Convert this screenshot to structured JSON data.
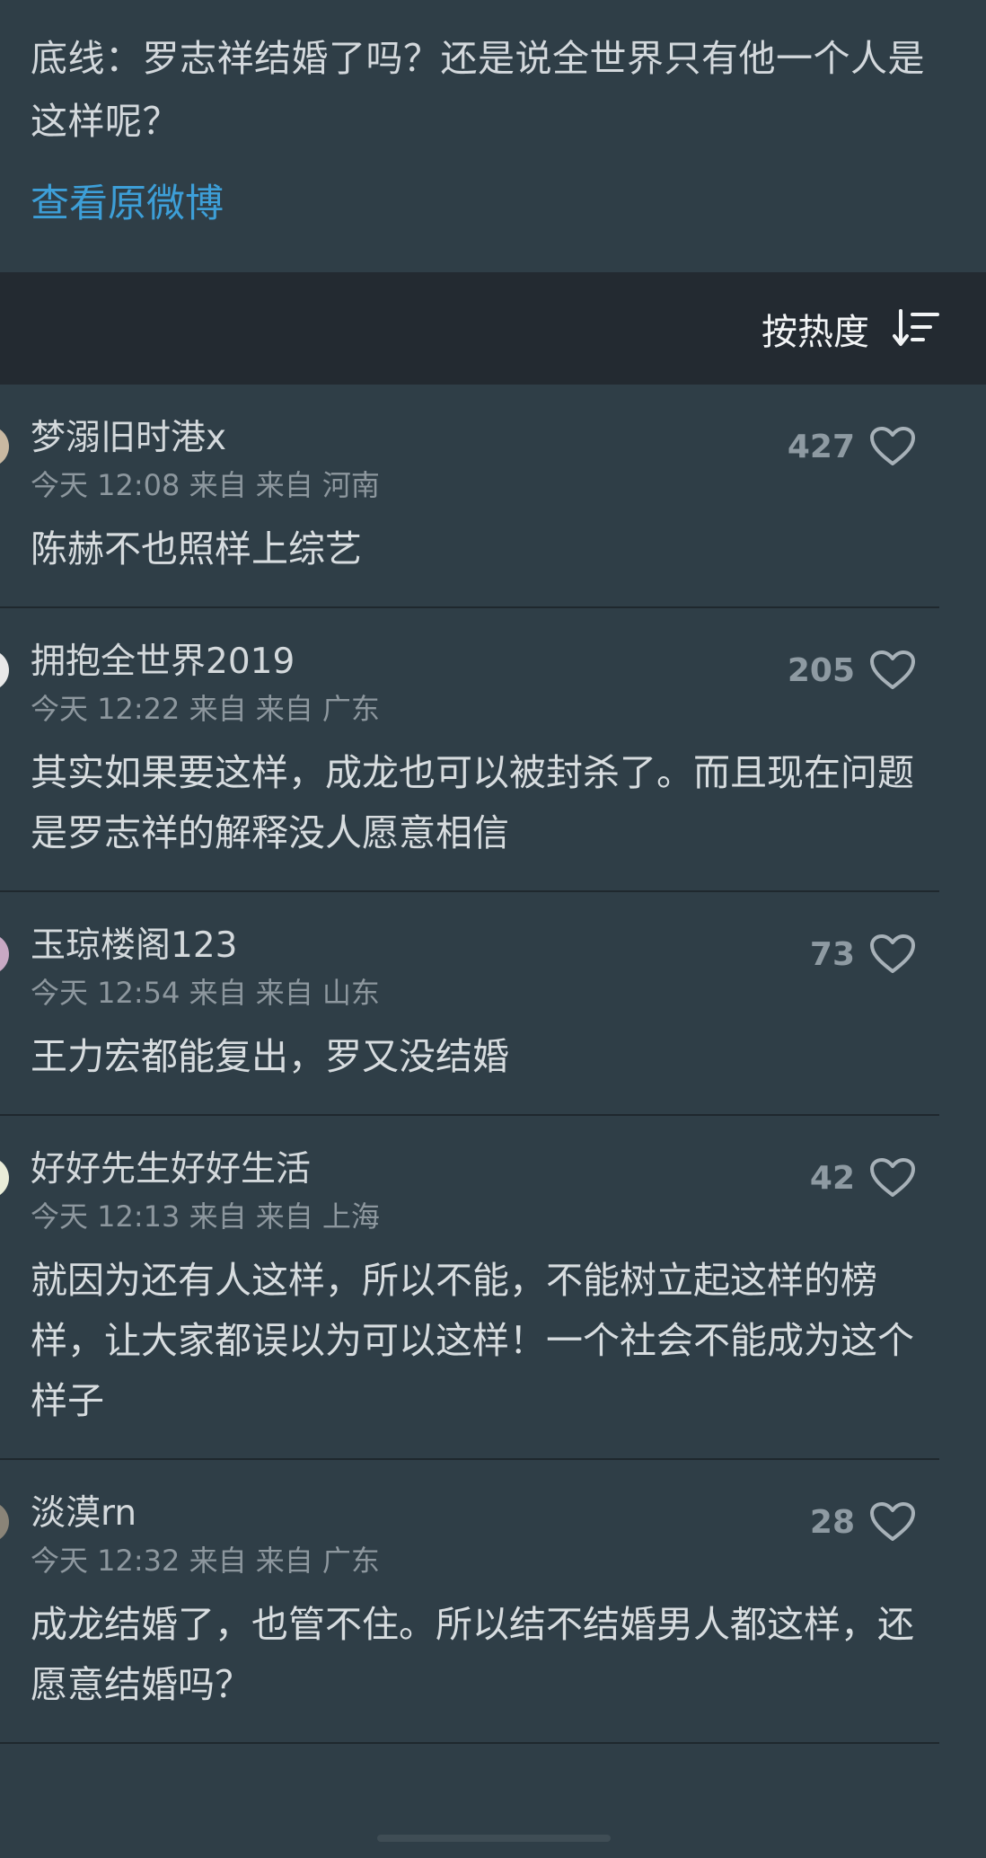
{
  "post": {
    "text": "底线：罗志祥结婚了吗？还是说全世界只有他一个人是这样呢？",
    "view_original": "查看原微博"
  },
  "sort": {
    "label": "按热度",
    "icon": "sort-icon"
  },
  "colors": {
    "background": "#2f3e47",
    "sort_bar": "#232a31",
    "link": "#3d9fd8",
    "muted": "#8d979e"
  },
  "comments": [
    {
      "username": "梦溺旧时港x",
      "meta": "今天 12:08 来自 来自 河南",
      "content": "陈赫不也照样上综艺",
      "likes": "427",
      "avatar_color": "#c9b9a2"
    },
    {
      "username": "拥抱全世界2019",
      "meta": "今天 12:22 来自 来自 广东",
      "content": "其实如果要这样，成龙也可以被封杀了。而且现在问题是罗志祥的解释没人愿意相信",
      "likes": "205",
      "avatar_color": "#e8e8e8"
    },
    {
      "username": "玉琼楼阁123",
      "meta": "今天 12:54 来自 来自 山东",
      "content": "王力宏都能复出，罗又没结婚",
      "likes": "73",
      "avatar_color": "#c8a9c4"
    },
    {
      "username": "好好先生好好生活",
      "meta": "今天 12:13 来自 来自 上海",
      "content": "就因为还有人这样，所以不能，不能树立起这样的榜样，让大家都误以为可以这样！一个社会不能成为这个样子",
      "likes": "42",
      "avatar_color": "#e9ecd8"
    },
    {
      "username": "淡漠rn",
      "meta": "今天 12:32 来自 来自 广东",
      "content": "成龙结婚了，也管不住。所以结不结婚男人都这样，还愿意结婚吗？",
      "likes": "28",
      "avatar_color": "#8a8478"
    }
  ]
}
